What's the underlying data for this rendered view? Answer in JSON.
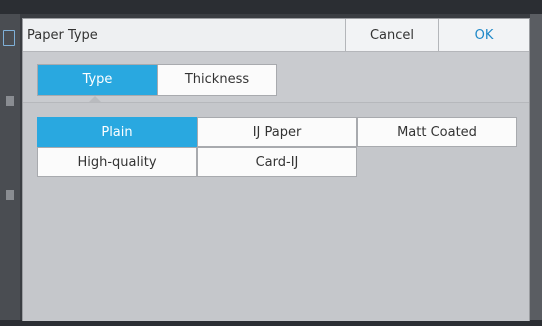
{
  "dialog": {
    "title": "Paper Type",
    "cancel_label": "Cancel",
    "ok_label": "OK"
  },
  "tabs": [
    {
      "label": "Type",
      "selected": true
    },
    {
      "label": "Thickness",
      "selected": false
    }
  ],
  "options": [
    {
      "label": "Plain",
      "selected": true
    },
    {
      "label": "IJ Paper",
      "selected": false
    },
    {
      "label": "Matt Coated",
      "selected": false
    },
    {
      "label": "High-quality",
      "selected": false
    },
    {
      "label": "Card-IJ",
      "selected": false
    }
  ],
  "colors": {
    "accent": "#29a8e0",
    "ok_text": "#1e88c8",
    "panel": "#c5c7cb"
  }
}
